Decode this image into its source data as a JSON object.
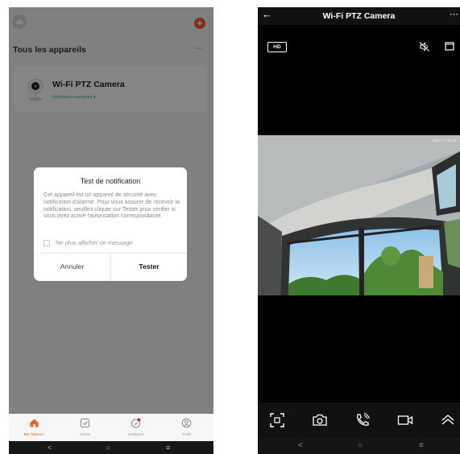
{
  "left_screen": {
    "header_title": "Tous les appareils",
    "more_icon": "⋯",
    "add_icon": "+",
    "device": {
      "name": "Wi-Fi PTZ Camera",
      "subtitle": "Fonctions courantes ▾"
    },
    "dialog": {
      "title": "Test de notification",
      "body": "Cet appareil est un appareil de sécurité avec notification d'alarme. Pour vous assurer de recevoir la notification, veuillez cliquer sur Tester pour vérifier si vous avez activé l'autorisation correspondante.",
      "checkbox_label": "Ne plus afficher ce message",
      "cancel_label": "Annuler",
      "confirm_label": "Tester"
    },
    "tabs": [
      {
        "label": "Ma \"Maison\"",
        "icon": "home-icon",
        "active": true
      },
      {
        "label": "Scène",
        "icon": "scene-icon",
        "active": false
      },
      {
        "label": "Intelligent",
        "icon": "smart-icon",
        "active": false
      },
      {
        "label": "Profil",
        "icon": "profile-icon",
        "active": false
      }
    ],
    "nav": {
      "back": "<",
      "home": "○",
      "recents": "≡"
    }
  },
  "right_screen": {
    "title": "Wi-Fi PTZ Camera",
    "back_icon": "←",
    "more_icon": "⋯",
    "quality_label": "HD",
    "timestamp": "2022-07-26 14:",
    "controls": [
      "screenshot-icon",
      "camera-icon",
      "call-icon",
      "record-icon",
      "expand-up-icon"
    ],
    "nav": {
      "back": "<",
      "home": "○",
      "recents": "≡"
    }
  },
  "colors": {
    "accent": "#ff5a1f",
    "green": "#36b37e",
    "overlay": "rgba(0,0,0,0.48)"
  }
}
